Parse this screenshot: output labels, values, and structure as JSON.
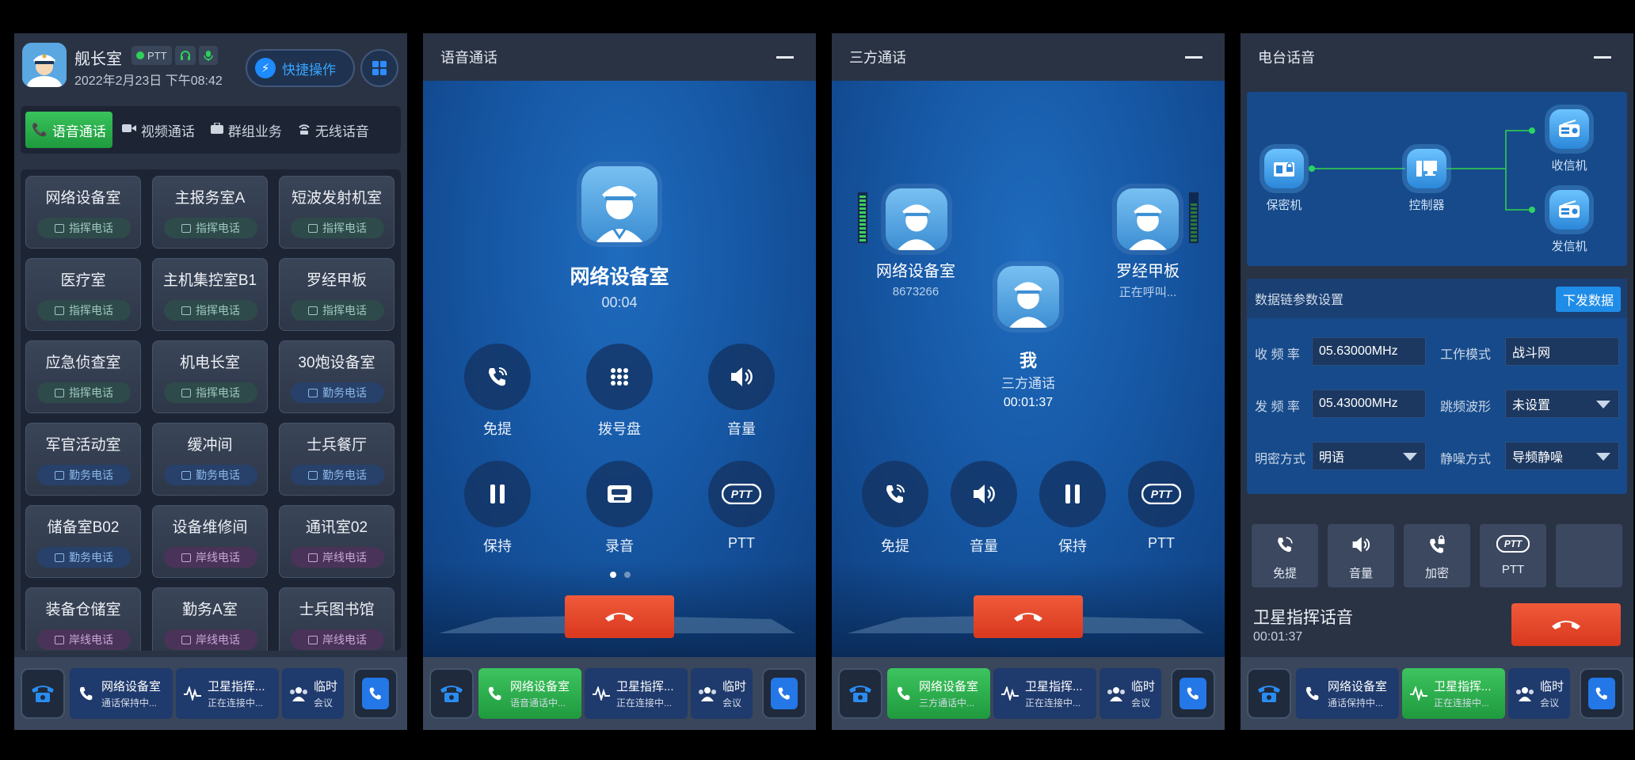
{
  "panel1": {
    "title": "舰长室",
    "date": "2022年2月23日 下午08:42",
    "ptt_label": "PTT",
    "quick_label": "快捷操作",
    "tabs": [
      {
        "label": "语音通话",
        "icon": "phone-icon"
      },
      {
        "label": "视频通话",
        "icon": "video-icon"
      },
      {
        "label": "群组业务",
        "icon": "briefcase-icon"
      },
      {
        "label": "无线话音",
        "icon": "wireless-icon"
      }
    ],
    "rooms": [
      {
        "name": "网络设备室",
        "tag": "指挥电话",
        "type": "cmd"
      },
      {
        "name": "主报务室A",
        "tag": "指挥电话",
        "type": "cmd"
      },
      {
        "name": "短波发射机室",
        "tag": "指挥电话",
        "type": "cmd"
      },
      {
        "name": "医疗室",
        "tag": "指挥电话",
        "type": "cmd"
      },
      {
        "name": "主机集控室B1",
        "tag": "指挥电话",
        "type": "cmd"
      },
      {
        "name": "罗经甲板",
        "tag": "指挥电话",
        "type": "cmd"
      },
      {
        "name": "应急侦查室",
        "tag": "指挥电话",
        "type": "cmd"
      },
      {
        "name": "机电长室",
        "tag": "指挥电话",
        "type": "cmd"
      },
      {
        "name": "30炮设备室",
        "tag": "勤务电话",
        "type": "duty"
      },
      {
        "name": "军官活动室",
        "tag": "勤务电话",
        "type": "duty"
      },
      {
        "name": "缓冲间",
        "tag": "勤务电话",
        "type": "duty"
      },
      {
        "name": "士兵餐厅",
        "tag": "勤务电话",
        "type": "duty"
      },
      {
        "name": "储备室B02",
        "tag": "勤务电话",
        "type": "duty"
      },
      {
        "name": "设备维修间",
        "tag": "岸线电话",
        "type": "shore"
      },
      {
        "name": "通讯室02",
        "tag": "岸线电话",
        "type": "shore"
      },
      {
        "name": "装备仓储室",
        "tag": "岸线电话",
        "type": "shore"
      },
      {
        "name": "勤务A室",
        "tag": "岸线电话",
        "type": "shore"
      },
      {
        "name": "士兵图书馆",
        "tag": "岸线电话",
        "type": "shore"
      }
    ]
  },
  "docks": {
    "p1": [
      {
        "title": "网络设备室",
        "sub": "通话保持中...",
        "active": false
      },
      {
        "title": "卫星指挥...",
        "sub": "正在连接中...",
        "active": false
      },
      {
        "title": "临时",
        "sub": "会议",
        "active": false
      }
    ],
    "p2": [
      {
        "title": "网络设备室",
        "sub": "语音通话中...",
        "active": true
      },
      {
        "title": "卫星指挥...",
        "sub": "正在连接中...",
        "active": false
      },
      {
        "title": "临时",
        "sub": "会议",
        "active": false
      }
    ],
    "p3": [
      {
        "title": "网络设备室",
        "sub": "三方通话中...",
        "active": true
      },
      {
        "title": "卫星指挥...",
        "sub": "正在连接中...",
        "active": false
      },
      {
        "title": "临时",
        "sub": "会议",
        "active": false
      }
    ],
    "p4": [
      {
        "title": "网络设备室",
        "sub": "通话保持中...",
        "active": false
      },
      {
        "title": "卫星指挥...",
        "sub": "正在连接中...",
        "active": true
      },
      {
        "title": "临时",
        "sub": "会议",
        "active": false
      }
    ]
  },
  "panel2": {
    "title": "语音通话",
    "name": "网络设备室",
    "time": "00:04",
    "buttons": [
      {
        "label": "免提",
        "icon": "speakerphone-icon"
      },
      {
        "label": "拨号盘",
        "icon": "dialpad-icon"
      },
      {
        "label": "音量",
        "icon": "volume-icon"
      },
      {
        "label": "保持",
        "icon": "pause-icon"
      },
      {
        "label": "录音",
        "icon": "cassette-icon"
      },
      {
        "label": "PTT",
        "icon": "ptt-icon"
      }
    ]
  },
  "panel3": {
    "title": "三方通话",
    "left_name": "网络设备室",
    "left_sub": "8673266",
    "right_name": "罗经甲板",
    "right_sub": "正在呼叫...",
    "me_name": "我",
    "me_sub": "三方通话",
    "me_time": "00:01:37",
    "buttons": [
      {
        "label": "免提",
        "icon": "speakerphone-icon"
      },
      {
        "label": "音量",
        "icon": "volume-icon"
      },
      {
        "label": "保持",
        "icon": "pause-icon"
      },
      {
        "label": "PTT",
        "icon": "ptt-icon"
      }
    ]
  },
  "panel4": {
    "title": "电台话音",
    "nodes": {
      "crypto": "保密机",
      "controller": "控制器",
      "receiver": "收信机",
      "transmitter": "发信机"
    },
    "params_title": "数据链参数设置",
    "send_label": "下发数据",
    "fields": {
      "rx_label": "收 频 率",
      "rx_value": "05.63000MHz",
      "mode_label": "工作模式",
      "mode_value": "战斗网",
      "tx_label": "发 频 率",
      "tx_value": "05.43000MHz",
      "hop_label": "跳频波形",
      "hop_value": "未设置",
      "crypt_label": "明密方式",
      "crypt_value": "明语",
      "squelch_label": "静噪方式",
      "squelch_value": "导频静噪"
    },
    "controls": [
      {
        "label": "免提",
        "icon": "speakerphone-icon"
      },
      {
        "label": "音量",
        "icon": "volume-icon"
      },
      {
        "label": "加密",
        "icon": "lock-phone-icon"
      },
      {
        "label": "PTT",
        "icon": "ptt-icon"
      },
      {
        "label": "",
        "icon": ""
      }
    ],
    "call_title": "卫星指挥话音",
    "call_time": "00:01:37"
  },
  "colors": {
    "accent_green": "#2fb14f",
    "accent_blue": "#1f8de8",
    "hangup_red": "#e8462a",
    "panel_bg": "#2a3344"
  }
}
